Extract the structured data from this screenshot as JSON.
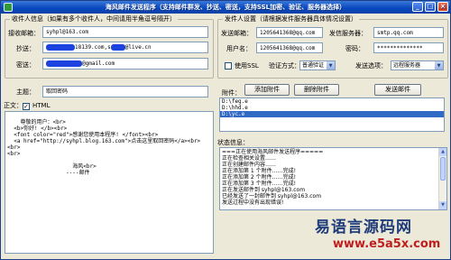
{
  "window": {
    "title": "海风邮件发送程序（支持邮件群发、抄送、密送，支持SSL加密、验证、服务器选择）",
    "icon": "app-mail-icon"
  },
  "recipient_group": {
    "title": "收件人信息（如果有多个收件人，中间请用半角逗号隔开）",
    "to_label": "接收邮箱：",
    "to_value": "syhpl@163.com",
    "cc_label": "抄送：",
    "cc_value_visible": "18139.com,s",
    "cc_value_tail": "@live.cn",
    "bcc_label": "密送：",
    "bcc_value_visible": "@gmail.com"
  },
  "sender_group": {
    "title": "发件人设置（请根据发件服务器具体情况设置）",
    "account_label": "发送邮箱：",
    "account_value": "1205641368@qq.com",
    "server_label": "发信服务器：",
    "server_value": "smtp.qq.com",
    "username_label": "用户名：",
    "username_value": "1205641368@qq.com",
    "password_label": "密码：",
    "password_value": "**************",
    "ssl_label": "使用SSL",
    "auth_label": "验证方式：",
    "auth_value": "普通验证",
    "method_label": "发送选项：",
    "method_value": "远程服务器"
  },
  "subject": {
    "label": "主题：",
    "value": "取回密码"
  },
  "body": {
    "label": "正文：",
    "html_label": "HTML",
    "html_checked": true,
    "text": "尊敬的用户：<br>\n  <b>你好! </b><br>\n  <font color=\"red\">感谢您使用本程序! </font><br>\n  <a href=\"http://syhpl.blog.163.com\">点击这里取回密码</a><br>\n<br>\n<br>\n\n                    海风<br>\n                  ----邮件"
  },
  "attachments": {
    "label": "附件：",
    "add_button": "添加附件",
    "delete_button": "删除附件",
    "send_button": "发送邮件",
    "items": [
      "D:\\feg.e",
      "D:\\hhd.e",
      "D:\\yc.e"
    ],
    "selected_index": 2
  },
  "status": {
    "label": "状态信息：",
    "lines": [
      "===正在使用海风邮件发送程序=====",
      "正在检查相关设置……",
      "正在创建邮件内容……",
      "正在添加第 1 个附件……完成!",
      "正在添加第 2 个附件……完成!",
      "正在添加第 3 个附件……完成!",
      "正在发送邮件到  syhpl@163.com",
      "已经发送了一封邮件到  syhpl@163.com",
      "发送过程中没有出现错误!"
    ]
  },
  "watermark": {
    "title": "易语言源码网",
    "url": "www.e5a5x.com"
  },
  "colors": {
    "titlebar": "#0a4ac0",
    "selection": "#316ac5",
    "redaction": "#1c43e0",
    "watermark_title": "#1f3c7a",
    "watermark_url": "#bf1e1e"
  }
}
